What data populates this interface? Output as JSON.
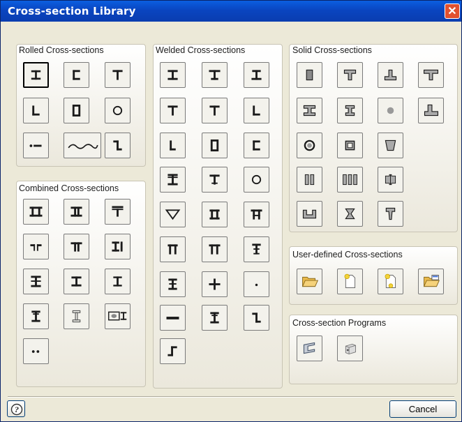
{
  "window": {
    "title": "Cross-section Library",
    "close_symbol": "✕"
  },
  "groups": {
    "rolled": {
      "title": "Rolled Cross-sections"
    },
    "combined": {
      "title": "Combined Cross-sections"
    },
    "welded": {
      "title": "Welded Cross-sections"
    },
    "solid": {
      "title": "Solid Cross-sections"
    },
    "user_defined": {
      "title": "User-defined Cross-sections"
    },
    "programs": {
      "title": "Cross-section Programs"
    }
  },
  "footer": {
    "cancel_label": "Cancel",
    "help_symbol": "?"
  },
  "icons": {
    "rolled": [
      "i-beam-icon",
      "channel-icon",
      "t-section-icon",
      "angle-icon",
      "rectangular-hollow-icon",
      "circular-hollow-icon",
      "flat-bar-icon",
      "corrugated-sheet-icon",
      "z-section-icon"
    ],
    "combined": [
      "double-i-icon",
      "back-to-back-channel-icon",
      "t-with-plate-icon",
      "double-angle-icon",
      "double-t-icon",
      "i-with-flat-icon",
      "i-with-plate-icon",
      "i-double-flange-icon",
      "i-small-icon",
      "i-with-top-plate-icon",
      "i-thin-icon",
      "box-with-i-icon",
      "double-flat-bar-icon"
    ],
    "welded": [
      "welded-i-icon",
      "welded-i-asym-icon",
      "welded-i-wide-icon",
      "welded-t-icon",
      "welded-t-wide-icon",
      "welded-angle-icon",
      "welded-l-icon",
      "welded-box-icon",
      "welded-channel-icon",
      "welded-i-heavy-icon",
      "welded-t-heavy-icon",
      "welded-pipe-icon",
      "welded-trapezoid-icon",
      "welded-box-flange-icon",
      "welded-box-plate-icon",
      "welded-pi-icon",
      "welded-pi-wide-icon",
      "welded-i-stiffened-icon",
      "welded-i-cross-icon",
      "welded-cross-icon",
      "welded-point-icon",
      "welded-flat-icon",
      "welded-i-top-icon",
      "welded-z-icon",
      "welded-omega-icon"
    ],
    "solid": [
      "solid-rectangle-icon",
      "solid-t-icon",
      "solid-inverted-t-icon",
      "solid-t-wide-icon",
      "solid-i-icon",
      "solid-i-narrow-icon",
      "solid-circle-icon",
      "solid-l-icon",
      "solid-ring-icon",
      "solid-box-icon",
      "solid-trapezoid-icon",
      "solid-double-bar-icon",
      "solid-triple-bar-icon",
      "solid-split-block-icon",
      "solid-u-icon",
      "solid-hourglass-icon",
      "solid-t-tapered-icon"
    ],
    "user_defined": [
      "open-folder-icon",
      "new-document-icon",
      "paste-document-icon",
      "save-folder-icon"
    ],
    "programs": [
      "shape-thin-program-icon",
      "shape-massive-program-icon"
    ]
  }
}
